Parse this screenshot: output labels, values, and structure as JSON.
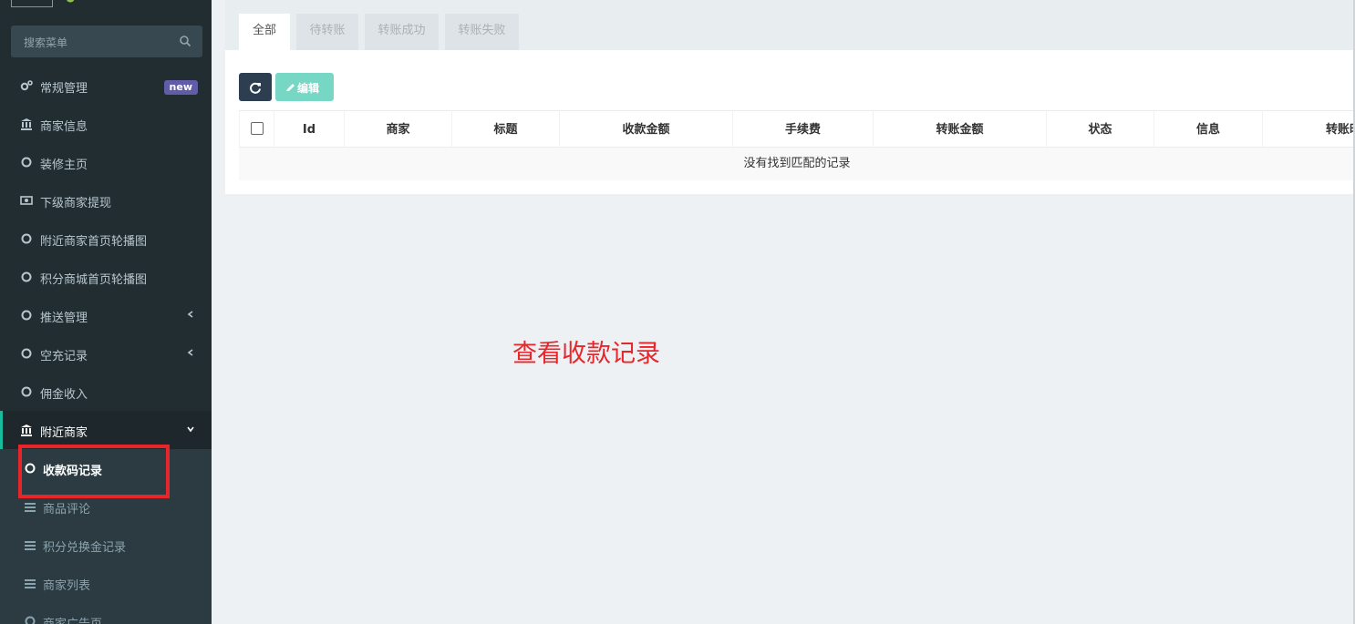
{
  "sidebar": {
    "search_placeholder": "搜索菜单",
    "items": [
      {
        "label": "常规管理",
        "icon": "cogs-icon",
        "badge": "new"
      },
      {
        "label": "商家信息",
        "icon": "bank-icon"
      },
      {
        "label": "装修主页",
        "icon": "circle-icon"
      },
      {
        "label": "下级商家提现",
        "icon": "money-icon"
      },
      {
        "label": "附近商家首页轮播图",
        "icon": "circle-icon"
      },
      {
        "label": "积分商城首页轮播图",
        "icon": "circle-icon"
      },
      {
        "label": "推送管理",
        "icon": "circle-icon",
        "expandable": true
      },
      {
        "label": "空充记录",
        "icon": "circle-icon",
        "expandable": true
      },
      {
        "label": "佣金收入",
        "icon": "circle-icon"
      },
      {
        "label": "附近商家",
        "icon": "bank-icon",
        "expanded": true
      }
    ],
    "subitems": [
      {
        "label": "收款码记录",
        "icon": "circle-icon",
        "current": true
      },
      {
        "label": "商品评论",
        "icon": "list-icon"
      },
      {
        "label": "积分兑换金记录",
        "icon": "list-icon"
      },
      {
        "label": "商家列表",
        "icon": "list-icon"
      },
      {
        "label": "商家广告页",
        "icon": "circle-icon"
      }
    ]
  },
  "tabs": [
    "全部",
    "待转账",
    "转账成功",
    "转账失败"
  ],
  "toolbar": {
    "edit_label": "编辑"
  },
  "table": {
    "headers": [
      "Id",
      "商家",
      "标题",
      "收款金额",
      "手续费",
      "转账金额",
      "状态",
      "信息",
      "转账时"
    ],
    "empty_message": "没有找到匹配的记录"
  },
  "annotation": "查看收款记录",
  "colors": {
    "sidebar_bg": "#222d32",
    "accent": "#18bc9c",
    "annotation": "#e8262a",
    "badge": "#605ca8"
  }
}
